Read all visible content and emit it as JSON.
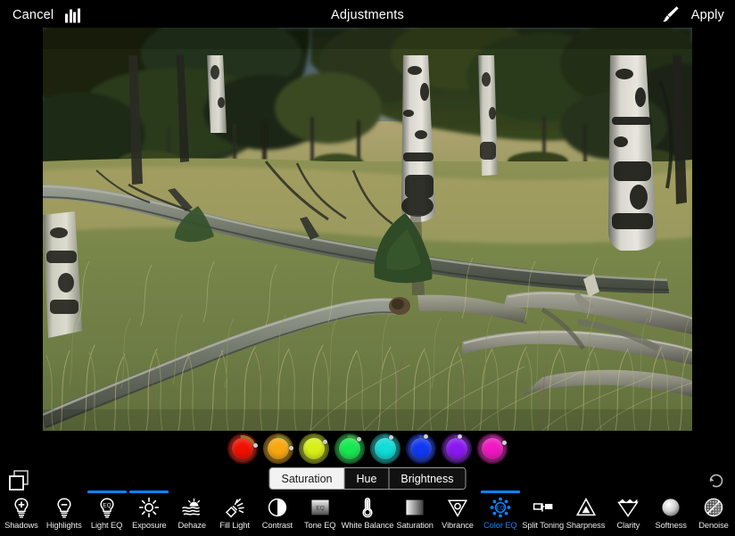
{
  "topbar": {
    "cancel_label": "Cancel",
    "histogram_icon": "histogram-icon",
    "title": "Adjustments",
    "brush_icon": "brush-icon",
    "apply_label": "Apply"
  },
  "photo": {
    "alt": "Forest meadow with birch trees, fallen logs and tall dry grass",
    "description": "Aspen and birch trunks along a grassy meadow with fallen weathered logs in the foreground"
  },
  "panel": {
    "layers_icon": "layers-icon",
    "reset_icon": "reset-icon",
    "swatches": [
      {
        "name": "red",
        "color": "#f01000",
        "ring": "#8a7a2a",
        "handle_angle": 28
      },
      {
        "name": "orange",
        "color": "#f7a810",
        "ring": "#6f7a2a",
        "handle_angle": 32
      },
      {
        "name": "yellow",
        "color": "#d8f018",
        "ring": "#6a7a2a",
        "handle_angle": 22
      },
      {
        "name": "green",
        "color": "#18e850",
        "ring": "#4a8a40",
        "handle_angle": 18
      },
      {
        "name": "cyan",
        "color": "#10dcd8",
        "ring": "#2a7a86",
        "handle_angle": 12
      },
      {
        "name": "blue",
        "color": "#1038f0",
        "ring": "#3a4a8a",
        "handle_angle": 10
      },
      {
        "name": "purple",
        "color": "#8a18f0",
        "ring": "#5a3a8a",
        "handle_angle": 8
      },
      {
        "name": "magenta",
        "color": "#f018c0",
        "ring": "#8a2a7a",
        "handle_angle": 24
      }
    ],
    "segments": [
      {
        "label": "Saturation",
        "selected": true
      },
      {
        "label": "Hue",
        "selected": false
      },
      {
        "label": "Brightness",
        "selected": false
      }
    ],
    "tools": [
      {
        "label": "Shadows",
        "icon": "bulb-plus-icon",
        "selected": false,
        "modified": false
      },
      {
        "label": "Highlights",
        "icon": "bulb-minus-icon",
        "selected": false,
        "modified": false
      },
      {
        "label": "Light EQ",
        "icon": "bulb-eq-icon",
        "selected": false,
        "modified": true
      },
      {
        "label": "Exposure",
        "icon": "sun-icon",
        "selected": false,
        "modified": true
      },
      {
        "label": "Dehaze",
        "icon": "haze-sun-icon",
        "selected": false,
        "modified": false
      },
      {
        "label": "Fill Light",
        "icon": "flashlight-icon",
        "selected": false,
        "modified": false
      },
      {
        "label": "Contrast",
        "icon": "half-circle-icon",
        "selected": false,
        "modified": false
      },
      {
        "label": "Tone EQ",
        "icon": "gradient-eq-icon",
        "selected": false,
        "modified": false
      },
      {
        "label": "White Balance",
        "icon": "thermometer-icon",
        "selected": false,
        "modified": false
      },
      {
        "label": "Saturation",
        "icon": "gradient-bar-icon",
        "selected": false,
        "modified": false
      },
      {
        "label": "Vibrance",
        "icon": "triangle-down-icon",
        "selected": false,
        "modified": false
      },
      {
        "label": "Color EQ",
        "icon": "color-eq-icon",
        "selected": true,
        "modified": true
      },
      {
        "label": "Split Toning",
        "icon": "split-tone-icon",
        "selected": false,
        "modified": false
      },
      {
        "label": "Sharpness",
        "icon": "triangle-up-icon",
        "selected": false,
        "modified": false
      },
      {
        "label": "Clarity",
        "icon": "diamond-icon",
        "selected": false,
        "modified": false
      },
      {
        "label": "Softness",
        "icon": "sphere-icon",
        "selected": false,
        "modified": false
      },
      {
        "label": "Denoise",
        "icon": "noise-circle-icon",
        "selected": false,
        "modified": false
      }
    ]
  },
  "colors": {
    "accent": "#0a84ff",
    "background": "#000000",
    "text": "#ffffff"
  }
}
